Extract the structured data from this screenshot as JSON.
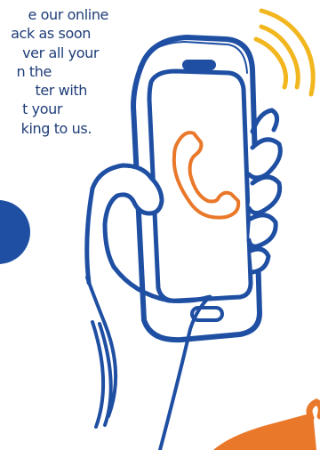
{
  "body_text": {
    "lines": [
      "e our online",
      "ack as soon",
      "ver all your",
      "n the",
      "ter with",
      "t your",
      "king to us."
    ]
  },
  "illustration": {
    "subject": "hand holding smartphone with phone-handset icon",
    "icons": [
      "phone-handset-icon",
      "signal-waves-icon"
    ],
    "colors": {
      "outline_blue": "#1f4fa3",
      "text_blue": "#1f3e78",
      "accent_orange": "#e9782a",
      "signal_yellow": "#f2b71f",
      "dot_blue": "#1f4fa3"
    }
  }
}
